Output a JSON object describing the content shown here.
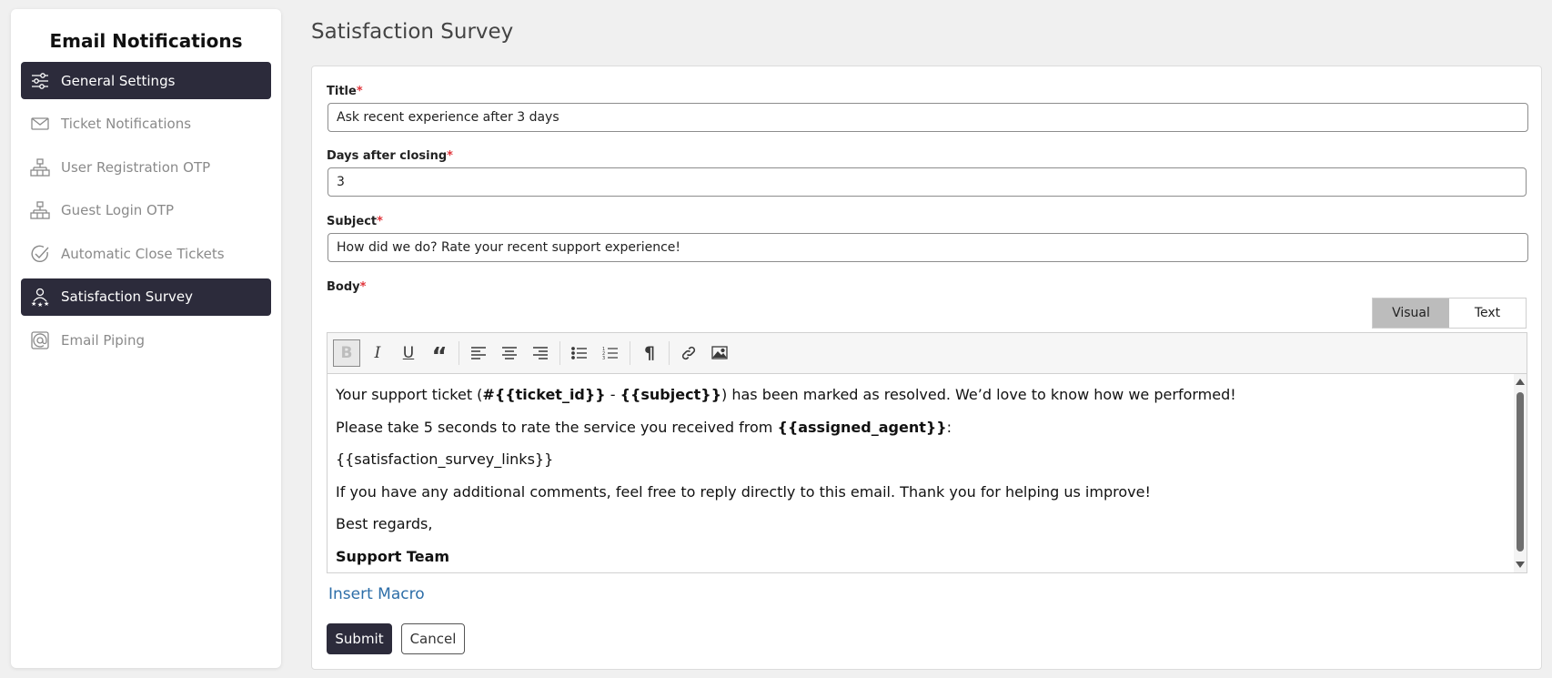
{
  "sidebar": {
    "title": "Email Notifications",
    "items": [
      {
        "label": "General Settings",
        "icon": "sliders-icon",
        "active": true
      },
      {
        "label": "Ticket Notifications",
        "icon": "envelope-icon",
        "active": false
      },
      {
        "label": "User Registration OTP",
        "icon": "network-icon",
        "active": false
      },
      {
        "label": "Guest Login OTP",
        "icon": "network-icon",
        "active": false
      },
      {
        "label": "Automatic Close Tickets",
        "icon": "check-circle-icon",
        "active": false
      },
      {
        "label": "Satisfaction Survey",
        "icon": "user-stars-icon",
        "active": true
      },
      {
        "label": "Email Piping",
        "icon": "at-icon",
        "active": false
      }
    ]
  },
  "main": {
    "page_title": "Satisfaction Survey",
    "form": {
      "title_label": "Title",
      "title_value": "Ask recent experience after 3 days",
      "days_label": "Days after closing",
      "days_value": "3",
      "subject_label": "Subject",
      "subject_value": "How did we do? Rate your recent support experience!",
      "body_label": "Body",
      "required_mark": "*"
    },
    "editor": {
      "mode_visual": "Visual",
      "mode_text": "Text",
      "active_mode": "Visual",
      "toolbar": [
        "bold",
        "italic",
        "underline",
        "blockquote",
        "align-left",
        "align-center",
        "align-right",
        "bullet-list",
        "numbered-list",
        "paragraph",
        "link",
        "image"
      ],
      "line1_a": "Your support ticket (",
      "line1_b": "#{{ticket_id}}",
      "line1_c": " - ",
      "line1_d": "{{subject}}",
      "line1_e": ") has been marked as resolved. We’d love to know how we performed!",
      "line2_a": "Please take 5 seconds to rate the service you received from ",
      "line2_b": "{{assigned_agent}}",
      "line2_c": ":",
      "line3": "{{satisfaction_survey_links}}",
      "line4": "If you have any additional comments, feel free to reply directly to this email. Thank you for helping us improve!",
      "line5": "Best regards,",
      "line6": "Support Team"
    },
    "insert_macro": "Insert Macro",
    "submit_label": "Submit",
    "cancel_label": "Cancel"
  },
  "colors": {
    "active_bg": "#2c2b3b",
    "link": "#2d6ea8",
    "required": "#e0353b"
  }
}
